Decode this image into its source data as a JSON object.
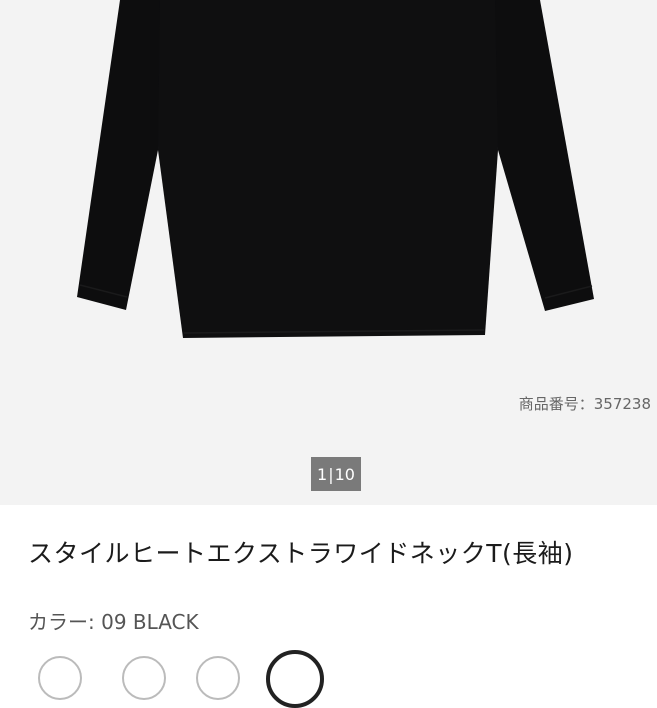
{
  "gallery": {
    "sku_label": "商品番号：357238",
    "page_current": "1",
    "page_total": "10",
    "page_separator": "|"
  },
  "product": {
    "title": "スタイルヒートエクストラワイドネックT(長袖)",
    "color_label": "カラー: 09 BLACK"
  },
  "colors": {
    "garment": "#0f0f10",
    "background": "#f3f3f3"
  }
}
